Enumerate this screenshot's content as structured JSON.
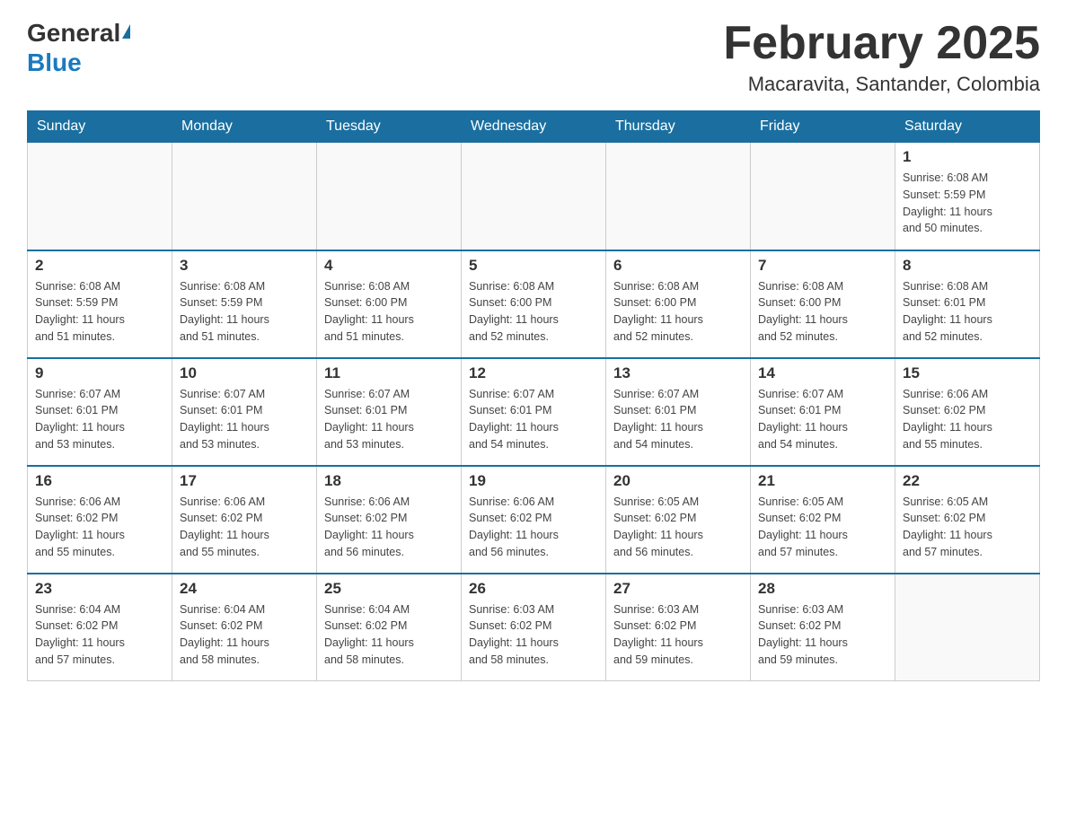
{
  "header": {
    "logo": {
      "general": "General",
      "blue": "Blue"
    },
    "title": "February 2025",
    "location": "Macaravita, Santander, Colombia"
  },
  "weekdays": [
    "Sunday",
    "Monday",
    "Tuesday",
    "Wednesday",
    "Thursday",
    "Friday",
    "Saturday"
  ],
  "weeks": [
    [
      {
        "day": "",
        "info": ""
      },
      {
        "day": "",
        "info": ""
      },
      {
        "day": "",
        "info": ""
      },
      {
        "day": "",
        "info": ""
      },
      {
        "day": "",
        "info": ""
      },
      {
        "day": "",
        "info": ""
      },
      {
        "day": "1",
        "info": "Sunrise: 6:08 AM\nSunset: 5:59 PM\nDaylight: 11 hours\nand 50 minutes."
      }
    ],
    [
      {
        "day": "2",
        "info": "Sunrise: 6:08 AM\nSunset: 5:59 PM\nDaylight: 11 hours\nand 51 minutes."
      },
      {
        "day": "3",
        "info": "Sunrise: 6:08 AM\nSunset: 5:59 PM\nDaylight: 11 hours\nand 51 minutes."
      },
      {
        "day": "4",
        "info": "Sunrise: 6:08 AM\nSunset: 6:00 PM\nDaylight: 11 hours\nand 51 minutes."
      },
      {
        "day": "5",
        "info": "Sunrise: 6:08 AM\nSunset: 6:00 PM\nDaylight: 11 hours\nand 52 minutes."
      },
      {
        "day": "6",
        "info": "Sunrise: 6:08 AM\nSunset: 6:00 PM\nDaylight: 11 hours\nand 52 minutes."
      },
      {
        "day": "7",
        "info": "Sunrise: 6:08 AM\nSunset: 6:00 PM\nDaylight: 11 hours\nand 52 minutes."
      },
      {
        "day": "8",
        "info": "Sunrise: 6:08 AM\nSunset: 6:01 PM\nDaylight: 11 hours\nand 52 minutes."
      }
    ],
    [
      {
        "day": "9",
        "info": "Sunrise: 6:07 AM\nSunset: 6:01 PM\nDaylight: 11 hours\nand 53 minutes."
      },
      {
        "day": "10",
        "info": "Sunrise: 6:07 AM\nSunset: 6:01 PM\nDaylight: 11 hours\nand 53 minutes."
      },
      {
        "day": "11",
        "info": "Sunrise: 6:07 AM\nSunset: 6:01 PM\nDaylight: 11 hours\nand 53 minutes."
      },
      {
        "day": "12",
        "info": "Sunrise: 6:07 AM\nSunset: 6:01 PM\nDaylight: 11 hours\nand 54 minutes."
      },
      {
        "day": "13",
        "info": "Sunrise: 6:07 AM\nSunset: 6:01 PM\nDaylight: 11 hours\nand 54 minutes."
      },
      {
        "day": "14",
        "info": "Sunrise: 6:07 AM\nSunset: 6:01 PM\nDaylight: 11 hours\nand 54 minutes."
      },
      {
        "day": "15",
        "info": "Sunrise: 6:06 AM\nSunset: 6:02 PM\nDaylight: 11 hours\nand 55 minutes."
      }
    ],
    [
      {
        "day": "16",
        "info": "Sunrise: 6:06 AM\nSunset: 6:02 PM\nDaylight: 11 hours\nand 55 minutes."
      },
      {
        "day": "17",
        "info": "Sunrise: 6:06 AM\nSunset: 6:02 PM\nDaylight: 11 hours\nand 55 minutes."
      },
      {
        "day": "18",
        "info": "Sunrise: 6:06 AM\nSunset: 6:02 PM\nDaylight: 11 hours\nand 56 minutes."
      },
      {
        "day": "19",
        "info": "Sunrise: 6:06 AM\nSunset: 6:02 PM\nDaylight: 11 hours\nand 56 minutes."
      },
      {
        "day": "20",
        "info": "Sunrise: 6:05 AM\nSunset: 6:02 PM\nDaylight: 11 hours\nand 56 minutes."
      },
      {
        "day": "21",
        "info": "Sunrise: 6:05 AM\nSunset: 6:02 PM\nDaylight: 11 hours\nand 57 minutes."
      },
      {
        "day": "22",
        "info": "Sunrise: 6:05 AM\nSunset: 6:02 PM\nDaylight: 11 hours\nand 57 minutes."
      }
    ],
    [
      {
        "day": "23",
        "info": "Sunrise: 6:04 AM\nSunset: 6:02 PM\nDaylight: 11 hours\nand 57 minutes."
      },
      {
        "day": "24",
        "info": "Sunrise: 6:04 AM\nSunset: 6:02 PM\nDaylight: 11 hours\nand 58 minutes."
      },
      {
        "day": "25",
        "info": "Sunrise: 6:04 AM\nSunset: 6:02 PM\nDaylight: 11 hours\nand 58 minutes."
      },
      {
        "day": "26",
        "info": "Sunrise: 6:03 AM\nSunset: 6:02 PM\nDaylight: 11 hours\nand 58 minutes."
      },
      {
        "day": "27",
        "info": "Sunrise: 6:03 AM\nSunset: 6:02 PM\nDaylight: 11 hours\nand 59 minutes."
      },
      {
        "day": "28",
        "info": "Sunrise: 6:03 AM\nSunset: 6:02 PM\nDaylight: 11 hours\nand 59 minutes."
      },
      {
        "day": "",
        "info": ""
      }
    ]
  ]
}
